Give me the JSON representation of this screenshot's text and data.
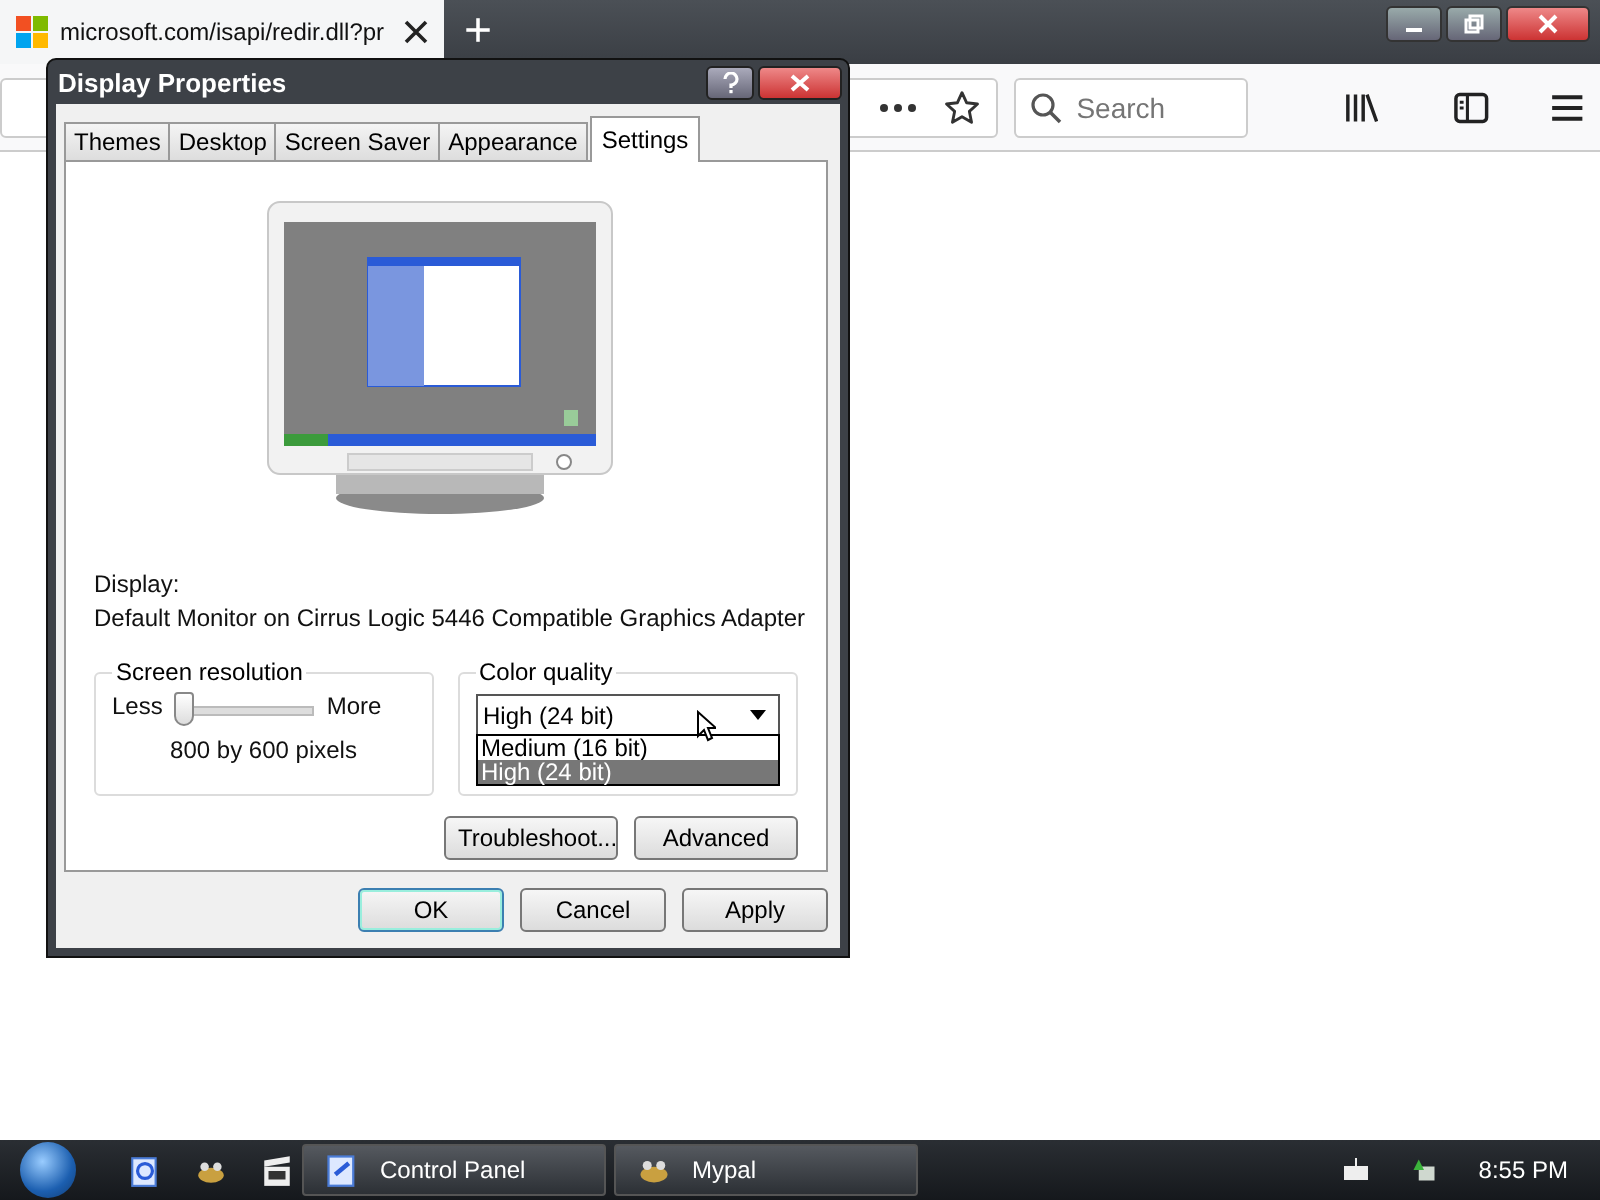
{
  "browser": {
    "tabs": [
      {
        "title": "microsoft.com/isapi/redir.dll?pr",
        "selected": true
      }
    ],
    "new_tab": "+",
    "search": {
      "placeholder": "Search"
    }
  },
  "dialog": {
    "title": "Display Properties",
    "tabs": [
      {
        "label": "Themes",
        "selected": false
      },
      {
        "label": "Desktop",
        "selected": false
      },
      {
        "label": "Screen Saver",
        "selected": false
      },
      {
        "label": "Appearance",
        "selected": false
      },
      {
        "label": "Settings",
        "selected": true
      }
    ],
    "display_label": "Display:",
    "display_value": "Default Monitor on Cirrus Logic 5446 Compatible Graphics Adapter",
    "resolution": {
      "title": "Screen resolution",
      "min_label": "Less",
      "max_label": "More",
      "level": 0,
      "reading": "800 by 600 pixels"
    },
    "color_quality": {
      "title": "Color quality",
      "value": "High (24 bit)",
      "expanded": true,
      "options": [
        {
          "label": "Medium (16 bit)",
          "selected": false
        },
        {
          "label": "High (24 bit)",
          "selected": true
        }
      ]
    },
    "buttons": [
      "Troubleshoot...",
      "Advanced"
    ],
    "footer_buttons": [
      {
        "label": "OK",
        "default": true
      },
      {
        "label": "Cancel",
        "default": false
      },
      {
        "label": "Apply",
        "default": false
      }
    ]
  },
  "taskbar": {
    "items": [
      {
        "label": "Control Panel",
        "kind": "panel"
      },
      {
        "label": "Mypal",
        "kind": "browser"
      }
    ],
    "clock": "8:55 PM"
  }
}
